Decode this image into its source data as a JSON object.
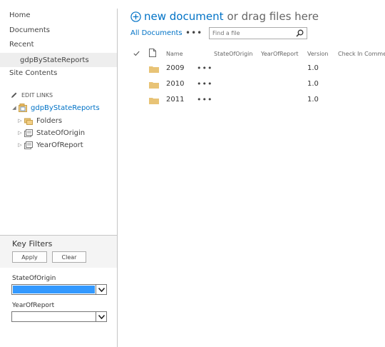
{
  "left_nav": {
    "items": [
      {
        "label": "Home"
      },
      {
        "label": "Documents"
      },
      {
        "label": "Recent"
      },
      {
        "label": "gdpByStateReports"
      },
      {
        "label": "Site Contents"
      }
    ],
    "edit_links": "EDIT LINKS"
  },
  "tree": {
    "root": "gdpByStateReports",
    "children": [
      {
        "label": "Folders",
        "icon": "folders-icon"
      },
      {
        "label": "StateOfOrigin",
        "icon": "metadata-icon"
      },
      {
        "label": "YearOfReport",
        "icon": "metadata-icon"
      }
    ]
  },
  "key_filters": {
    "title": "Key Filters",
    "apply": "Apply",
    "clear": "Clear",
    "fields": [
      {
        "label": "StateOfOrigin",
        "value": ""
      },
      {
        "label": "YearOfReport",
        "value": ""
      }
    ]
  },
  "main": {
    "new_document": "new document",
    "or_drag": "or drag files here",
    "view": "All Documents",
    "view_more": "•••",
    "search_placeholder": "Find a file"
  },
  "columns": [
    "Name",
    "StateOfOrigin",
    "YearOfReport",
    "Version",
    "Check In Comment"
  ],
  "rows": [
    {
      "name": "2009",
      "state": "",
      "year": "",
      "version": "1.0",
      "comment": ""
    },
    {
      "name": "2010",
      "state": "",
      "year": "",
      "version": "1.0",
      "comment": ""
    },
    {
      "name": "2011",
      "state": "",
      "year": "",
      "version": "1.0",
      "comment": ""
    }
  ],
  "colors": {
    "accent": "#0072c6",
    "selected_dropdown": "#3399ff",
    "folder": "#e8c376"
  }
}
